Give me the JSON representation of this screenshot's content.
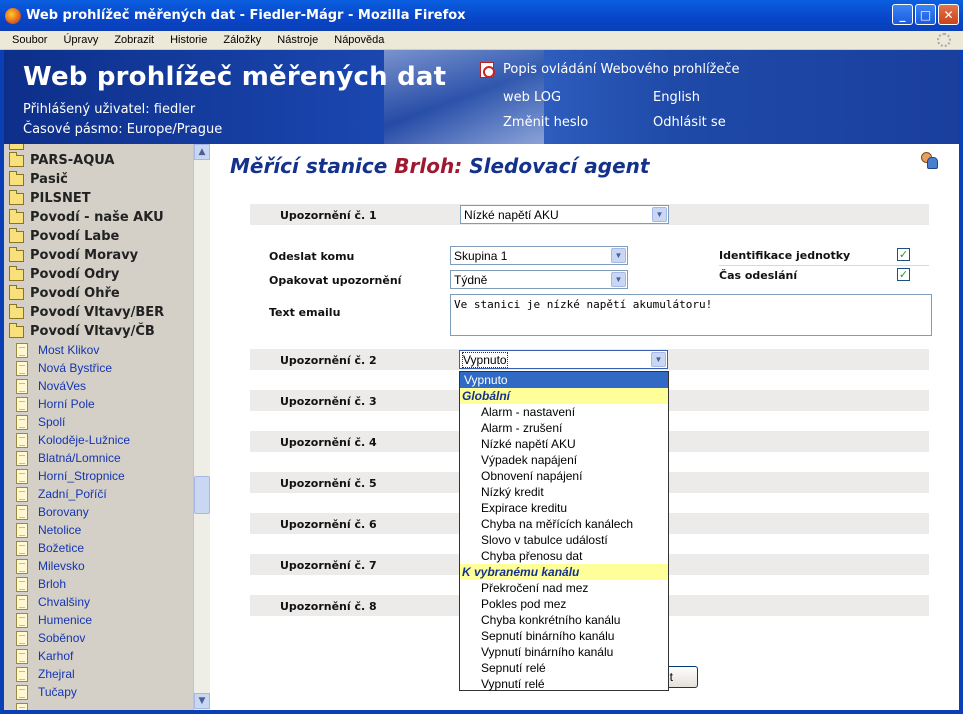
{
  "window": {
    "title": "Web prohlížeč měřených dat - Fiedler-Mágr - Mozilla Firefox",
    "minimize": "_",
    "maximize": "□",
    "close": "✕"
  },
  "menu": [
    "Soubor",
    "Úpravy",
    "Zobrazit",
    "Historie",
    "Záložky",
    "Nástroje",
    "Nápověda"
  ],
  "header": {
    "title": "Web prohlížeč měřených dat",
    "user_line": "Přihlášený uživatel: fiedler",
    "timezone_line": "Časové pásmo: Europe/Prague",
    "links": {
      "help": "Popis ovládání Webového prohlížeče",
      "weblog": "web LOG",
      "english": "English",
      "change_password": "Změnit heslo",
      "logout": "Odhlásit se"
    }
  },
  "sidebar": {
    "folders": [
      "PARS-AQUA",
      "Pasič",
      "PILSNET",
      "Povodí - naše AKU",
      "Povodí Labe",
      "Povodí Moravy",
      "Povodí Odry",
      "Povodí Ohře",
      "Povodí Vltavy/BER",
      "Povodí Vltavy/ČB"
    ],
    "stations": [
      "Most Klikov",
      "Nová Bystřice",
      "NováVes",
      "Horní Pole",
      "Spolí",
      "Koloděje-Lužnice",
      "Blatná/Lomnice",
      "Horní_Stropnice",
      "Zadní_Poříčí",
      "Borovany",
      "Netolice",
      "Božetice",
      "Milevsko",
      "Brloh",
      "Chvalšiny",
      "Humenice",
      "Soběnov",
      "Karhof",
      "Zhejral",
      "Tučapy"
    ]
  },
  "main": {
    "title_prefix": "Měřící stanice ",
    "station": "Brloh:",
    "title_suffix": " Sledovací agent",
    "alert1_label": "Upozornění č. 1",
    "alert1_value": "Nízké napětí AKU",
    "send_to_label": "Odeslat komu",
    "send_to_value": "Skupina 1",
    "repeat_label": "Opakovat upozornění",
    "repeat_value": "Týdně",
    "unit_id_label": "Identifikace jednotky",
    "send_time_label": "Čas odeslání",
    "email_text_label": "Text emailu",
    "email_text_value": "Ve stanici je nízké napětí akumulátoru!",
    "alerts": [
      {
        "label": "Upozornění č. 2",
        "value": "Vypnuto"
      },
      {
        "label": "Upozornění č. 3"
      },
      {
        "label": "Upozornění č. 4"
      },
      {
        "label": "Upozornění č. 5"
      },
      {
        "label": "Upozornění č. 6"
      },
      {
        "label": "Upozornění č. 7"
      },
      {
        "label": "Upozornění č. 8"
      }
    ],
    "button_partial": "t"
  },
  "dropdown": {
    "selected": "Vypnuto",
    "group_global": "Globální",
    "global_options": [
      "Alarm - nastavení",
      "Alarm - zrušení",
      "Nízké napětí AKU",
      "Výpadek napájení",
      "Obnovení napájení",
      "Nízký kredit",
      "Expirace kreditu",
      "Chyba na měřících kanálech",
      "Slovo v tabulce událostí",
      "Chyba přenosu dat"
    ],
    "group_channel": "K vybranému kanálu",
    "channel_options": [
      "Překročení nad mez",
      "Pokles pod mez",
      "Chyba konkrétního kanálu",
      "Sepnutí binárního kanálu",
      "Vypnutí binárního kanálu",
      "Sepnutí relé",
      "Vypnutí relé"
    ]
  },
  "colors": {
    "title_blue": "#14328c",
    "station_red": "#a01830",
    "link_blue": "#1535b0",
    "selected_bg": "#316ac5",
    "group_bg": "#ffff9a"
  }
}
